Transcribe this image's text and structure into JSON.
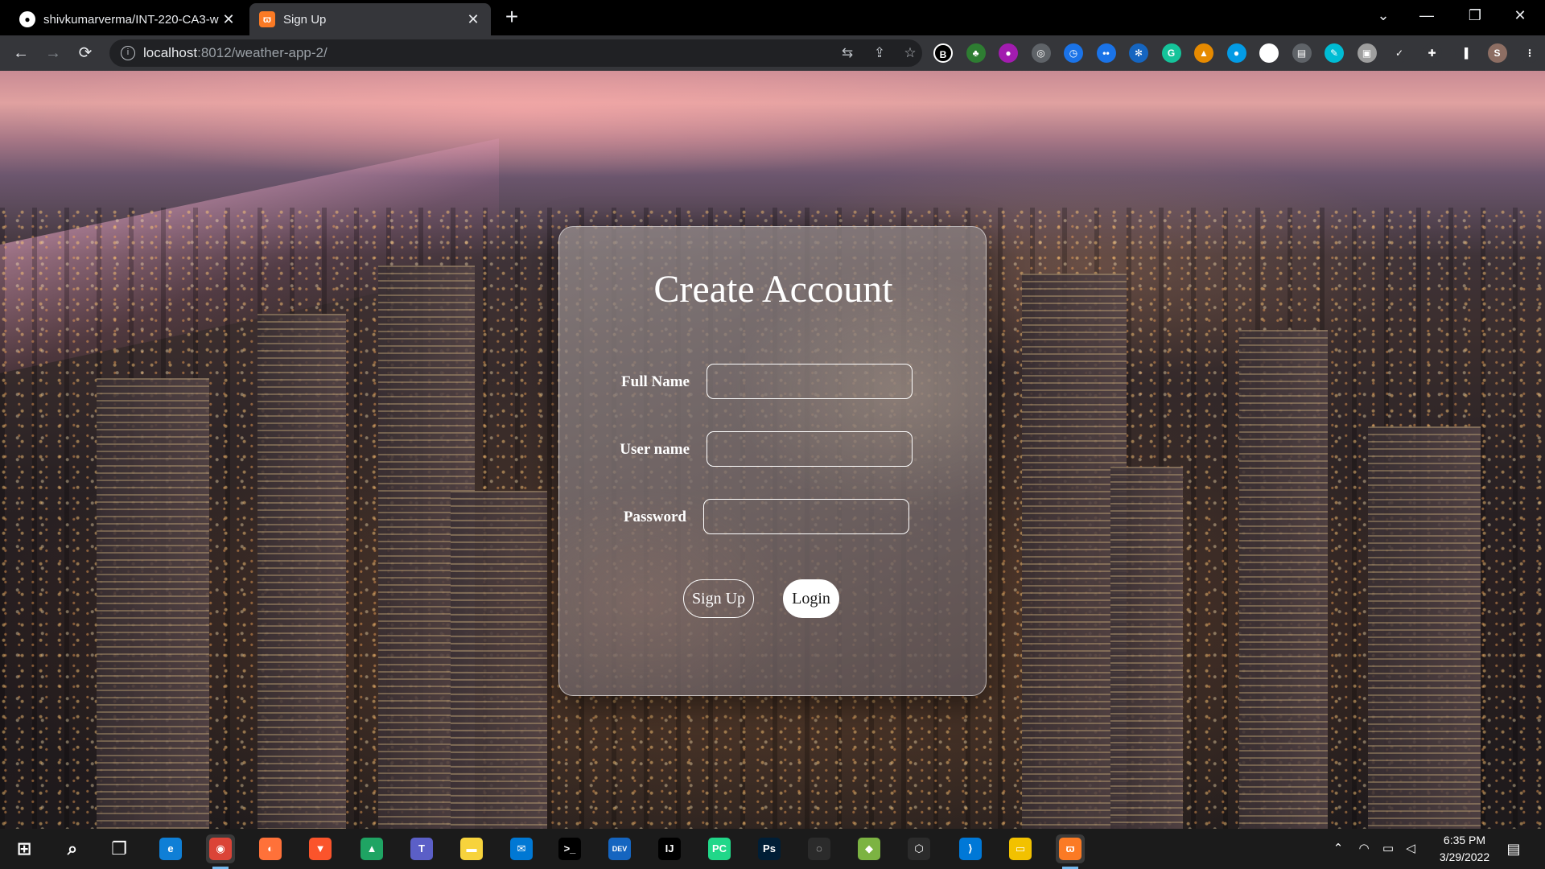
{
  "browser": {
    "tabs": [
      {
        "title": "shivkumarverma/INT-220-CA3-w",
        "favicon": "github-icon",
        "active": false
      },
      {
        "title": "Sign Up",
        "favicon": "xampp-icon",
        "active": true
      }
    ],
    "new_tab_glyph": "+",
    "window_controls": {
      "dropdown": "⌄",
      "minimize": "—",
      "restore": "❐",
      "close": "✕"
    },
    "nav": {
      "back": "←",
      "forward": "→",
      "reload": "⟳"
    },
    "url_host": "localhost",
    "url_path": ":8012/weather-app-2/",
    "omnibox_icons": [
      "translate-icon",
      "share-icon",
      "bookmark-star-icon"
    ],
    "extensions": [
      {
        "name": "b-extension-icon",
        "glyph": "B",
        "color": "#000000"
      },
      {
        "name": "tree-extension-icon",
        "glyph": "♣",
        "color": "#2e7d32"
      },
      {
        "name": "purple-extension-icon",
        "glyph": "●",
        "color": "#a21caf"
      },
      {
        "name": "owl-extension-icon",
        "glyph": "◎",
        "color": "#5f6368"
      },
      {
        "name": "clock-extension-icon",
        "glyph": "◷",
        "color": "#1a73e8"
      },
      {
        "name": "chat-extension-icon",
        "glyph": "••",
        "color": "#1a73e8"
      },
      {
        "name": "snowflake-extension-icon",
        "glyph": "✻",
        "color": "#1565c0"
      },
      {
        "name": "grammarly-icon",
        "glyph": "G",
        "color": "#15c39a"
      },
      {
        "name": "bird-extension-icon",
        "glyph": "▲",
        "color": "#e68a00"
      },
      {
        "name": "drop-extension-icon",
        "glyph": "●",
        "color": "#039be5"
      },
      {
        "name": "search-extension-icon",
        "glyph": "⌕",
        "color": "#ffffff"
      },
      {
        "name": "doc-extension-icon",
        "glyph": "▤",
        "color": "#5f6368"
      },
      {
        "name": "pen-extension-icon",
        "glyph": "✎",
        "color": "#00bcd4"
      },
      {
        "name": "image-extension-icon",
        "glyph": "▣",
        "color": "#9e9e9e"
      },
      {
        "name": "check-extension-icon",
        "glyph": "✓",
        "color": "#35363a"
      },
      {
        "name": "puzzle-icon",
        "glyph": "✚",
        "color": "#35363a"
      },
      {
        "name": "sidepanel-icon",
        "glyph": "▐",
        "color": "#35363a"
      },
      {
        "name": "profile-avatar",
        "glyph": "S",
        "color": "#8d6e63"
      },
      {
        "name": "menu-kebab-icon",
        "glyph": "⋮",
        "color": "#35363a"
      }
    ]
  },
  "form": {
    "title": "Create Account",
    "fields": [
      {
        "label": "Full Name",
        "value": "",
        "placeholder": ""
      },
      {
        "label": "User name",
        "value": "",
        "placeholder": ""
      },
      {
        "label": "Password",
        "value": "",
        "placeholder": ""
      }
    ],
    "signup_label": "Sign Up",
    "login_label": "Login"
  },
  "taskbar": {
    "apps": [
      {
        "name": "windows-start-icon",
        "glyph": "⊞",
        "color": "transparent"
      },
      {
        "name": "search-icon",
        "glyph": "⌕",
        "color": "transparent"
      },
      {
        "name": "task-view-icon",
        "glyph": "❐",
        "color": "transparent"
      },
      {
        "name": "edge-icon",
        "glyph": "e",
        "color": "#0f7fd6"
      },
      {
        "name": "chrome-icon",
        "glyph": "◉",
        "color": "#db4437"
      },
      {
        "name": "firefox-icon",
        "glyph": "◐",
        "color": "#ff7139"
      },
      {
        "name": "brave-icon",
        "glyph": "▼",
        "color": "#fb542b"
      },
      {
        "name": "google-drive-icon",
        "glyph": "▲",
        "color": "#1fa463"
      },
      {
        "name": "teams-icon",
        "glyph": "T",
        "color": "#5b5fc7"
      },
      {
        "name": "sticky-notes-icon",
        "glyph": "▬",
        "color": "#f7d33c"
      },
      {
        "name": "mail-icon",
        "glyph": "✉",
        "color": "#0078d4"
      },
      {
        "name": "terminal-icon",
        "glyph": ">_",
        "color": "#000000"
      },
      {
        "name": "dev-icon",
        "glyph": "DEV",
        "color": "#1565c0"
      },
      {
        "name": "intellij-icon",
        "glyph": "IJ",
        "color": "#000000"
      },
      {
        "name": "pycharm-icon",
        "glyph": "PC",
        "color": "#21d789"
      },
      {
        "name": "photoshop-icon",
        "glyph": "Ps",
        "color": "#001e36"
      },
      {
        "name": "obs-icon",
        "glyph": "◌",
        "color": "#2b2b2b"
      },
      {
        "name": "bluestacks-icon",
        "glyph": "◆",
        "color": "#7cb342"
      },
      {
        "name": "virtualbox-icon",
        "glyph": "⬡",
        "color": "#2b2b2b"
      },
      {
        "name": "vscode-icon",
        "glyph": "⟩",
        "color": "#0078d7"
      },
      {
        "name": "file-explorer-icon",
        "glyph": "▭",
        "color": "#f2c100"
      },
      {
        "name": "xampp-icon",
        "glyph": "ϖ",
        "color": "#fb7a24"
      }
    ],
    "tray": [
      "chevron-up-icon",
      "wifi-icon",
      "battery-icon",
      "volume-icon"
    ],
    "time": "6:35 PM",
    "date": "3/29/2022",
    "notification_icon": "notification-icon"
  }
}
